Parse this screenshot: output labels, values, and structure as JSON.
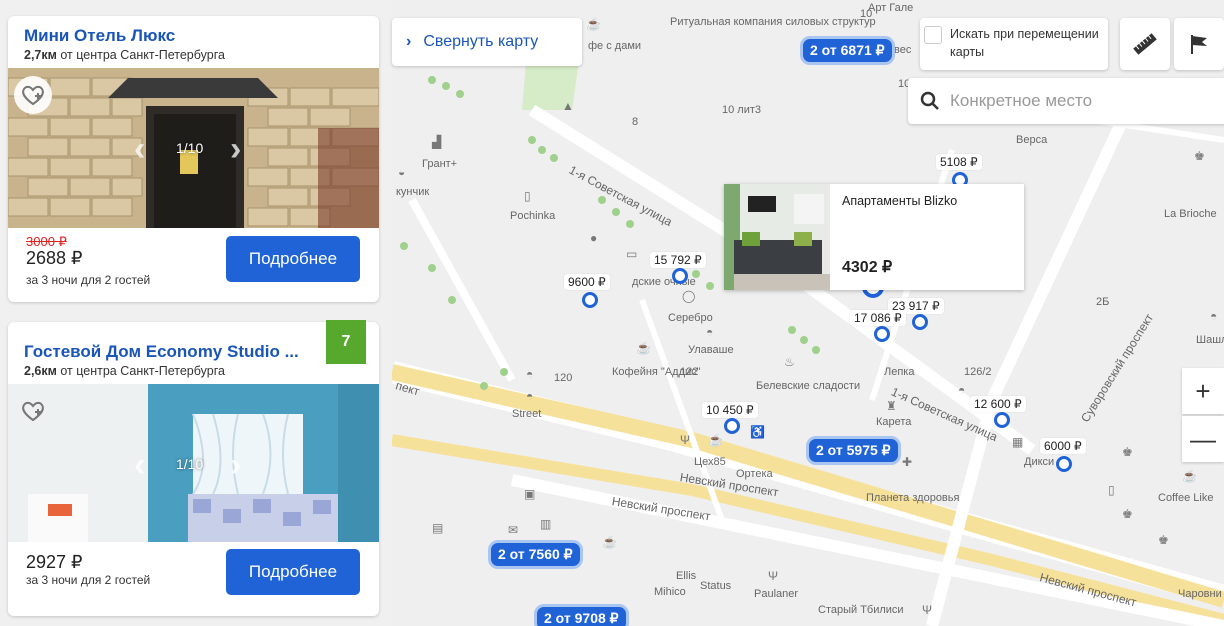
{
  "hotels": [
    {
      "title": "Мини Отель Люкс",
      "distance_value": "2,7км",
      "distance_suffix": "от центра Санкт-Петербурга",
      "photo_counter": "1/10",
      "old_price": "3000 ₽",
      "price": "2688 ₽",
      "nights": "за 3 ночи для 2 гостей",
      "button": "Подробнее"
    },
    {
      "title": "Гостевой Дом Economy Studio ...",
      "distance_value": "2,6км",
      "distance_suffix": "от центра Санкт-Петербурга",
      "photo_counter": "1/10",
      "price": "2927 ₽",
      "nights": "за 3 ночи для 2 гостей",
      "button": "Подробнее",
      "rating": "7"
    }
  ],
  "map": {
    "collapse_label": "Свернуть карту",
    "search_on_move_label": "Искать при перемещении карты",
    "search_placeholder": "Конкретное место",
    "zoom_in": "+",
    "zoom_out": "—",
    "popup": {
      "title": "Апартаменты Blizko",
      "price": "4302 ₽"
    },
    "price_chips": [
      "5108 ₽",
      "15 792 ₽",
      "9600 ₽",
      "23 917 ₽",
      "17 086 ₽",
      "10 450 ₽",
      "12 600 ₽",
      "6000 ₽"
    ],
    "clusters": [
      "2 от 6871 ₽",
      "2 от 5975 ₽",
      "2 от 7560 ₽",
      "2 от 9708 ₽"
    ],
    "streets": {
      "sovetskaya1": "1-я Советская улица",
      "sovetskaya1b": "1-я Советская улица",
      "nevsky1": "Невский проспект",
      "nevsky2": "Невский проспект",
      "nevsky3": "Невский проспект",
      "suvorovsky": "Суворовский проспект",
      "prospekt_left": "пект"
    },
    "labels": {
      "ritual": "Ритуальная компания силовых структур",
      "cafe": "фе с дами",
      "art": "Арт Гале",
      "ves": "вес",
      "num10": "10",
      "num10b": "10",
      "lit3": "10 лит3",
      "num8": "8",
      "versa": "Верса",
      "grant": "Грант+",
      "kunchik": "кунчик",
      "pochinka": "Pochinka",
      "labrioche": "La Brioche",
      "dskie": "дские очные",
      "serebro": "Серебро",
      "ulavashe": "Улаваше",
      "kofeynya": "Кофейня \"Аддис\"",
      "num122": "122",
      "num120": "120",
      "street": "Street",
      "belevskie": "Белевские сладости",
      "lepka": "Лепка",
      "num126": "126/2",
      "num26": "2Б",
      "shash": "Шашл Хаус",
      "kareta": "Карета",
      "tseh": "Цех85",
      "orteka": "Ортека",
      "planeta": "Планета здоровья",
      "diksi": "Дикси",
      "coffeelike": "Coffee Like",
      "ellis": "Ellis",
      "status": "Status",
      "mihico": "Mihico",
      "paulaner": "Paulaner",
      "stary": "Старый Тбилиси",
      "charovni": "Чаровни"
    }
  }
}
